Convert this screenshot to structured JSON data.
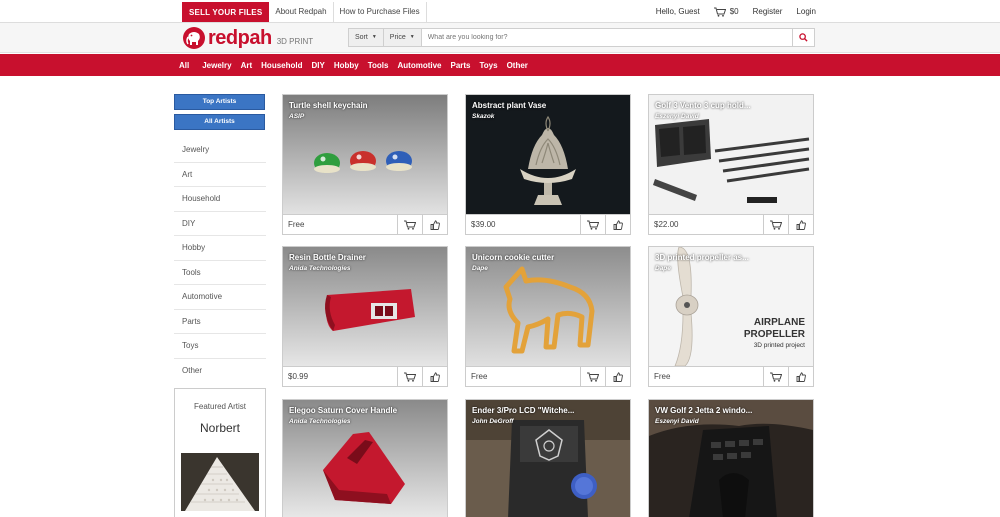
{
  "topbar": {
    "sell_label": "SELL YOUR FILES",
    "about_label": "About Redpah",
    "howto_label": "How to Purchase Files",
    "greeting": "Hello, Guest",
    "cart_total": "$0",
    "register_label": "Register",
    "login_label": "Login"
  },
  "header": {
    "logo_text": "redpah",
    "logo_sub": "3D PRINT",
    "sort_label": "Sort",
    "price_label": "Price",
    "search_placeholder": "What are you looking for?"
  },
  "nav": {
    "items": [
      "All",
      "Jewelry",
      "Art",
      "Household",
      "DIY",
      "Hobby",
      "Tools",
      "Automotive",
      "Parts",
      "Toys",
      "Other"
    ]
  },
  "sidebar": {
    "top_artists_label": "Top Artists",
    "all_artists_label": "All Artists",
    "categories": [
      "Jewelry",
      "Art",
      "Household",
      "DIY",
      "Hobby",
      "Tools",
      "Automotive",
      "Parts",
      "Toys",
      "Other"
    ],
    "featured_title": "Featured Artist",
    "featured_name": "Norbert"
  },
  "products": [
    {
      "title": "Turtle shell keychain",
      "author": "ASIP",
      "price": "Free"
    },
    {
      "title": "Abstract plant Vase",
      "author": "Skazok",
      "price": "$39.00"
    },
    {
      "title": "Golf 3 Vento 3 cup hold...",
      "author": "Eszenyi David",
      "price": "$22.00"
    },
    {
      "title": "Resin Bottle Drainer",
      "author": "Anida Technologies",
      "price": "$0.99"
    },
    {
      "title": "Unicorn cookie cutter",
      "author": "Dape",
      "price": "Free"
    },
    {
      "title": "3D printed propeller as...",
      "author": "Dape",
      "price": "Free",
      "overlay_line1": "AIRPLANE",
      "overlay_line2": "PROPELLER",
      "overlay_line3": "3D printed project"
    },
    {
      "title": "Elegoo Saturn Cover Handle",
      "author": "Anida Technologies"
    },
    {
      "title": "Ender 3/Pro LCD \"Witche...",
      "author": "John DeGroff"
    },
    {
      "title": "VW Golf 2 Jetta 2 windo...",
      "author": "Eszenyi David"
    }
  ],
  "colors": {
    "brand_red": "#c8102e",
    "button_blue": "#3b75c4"
  }
}
